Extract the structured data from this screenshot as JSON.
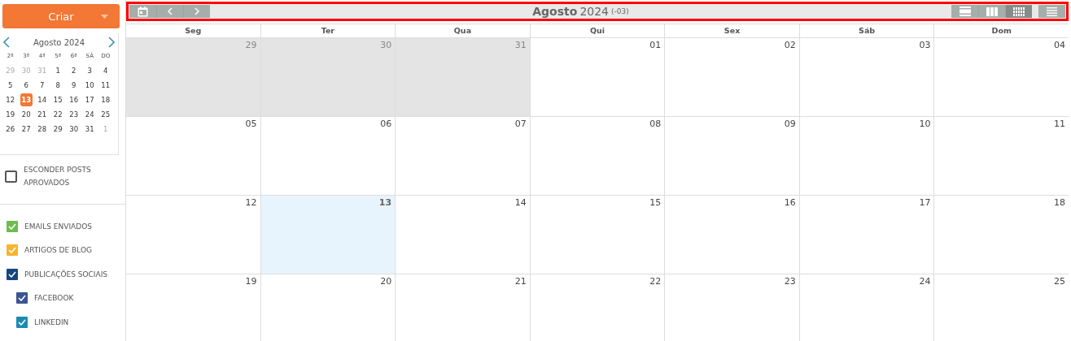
{
  "create_button": {
    "label": "Criar"
  },
  "mini_calendar": {
    "title": "Agosto 2024",
    "weekdays": [
      "2ª",
      "3ª",
      "4ª",
      "5ª",
      "6ª",
      "SÁ",
      "DO"
    ],
    "weeks": [
      [
        {
          "label": "29",
          "other_month": true,
          "selected": false
        },
        {
          "label": "30",
          "other_month": true,
          "selected": false
        },
        {
          "label": "31",
          "other_month": true,
          "selected": false
        },
        {
          "label": "1",
          "other_month": false,
          "selected": false
        },
        {
          "label": "2",
          "other_month": false,
          "selected": false
        },
        {
          "label": "3",
          "other_month": false,
          "selected": false
        },
        {
          "label": "4",
          "other_month": false,
          "selected": false
        }
      ],
      [
        {
          "label": "5",
          "other_month": false,
          "selected": false
        },
        {
          "label": "6",
          "other_month": false,
          "selected": false
        },
        {
          "label": "7",
          "other_month": false,
          "selected": false
        },
        {
          "label": "8",
          "other_month": false,
          "selected": false
        },
        {
          "label": "9",
          "other_month": false,
          "selected": false
        },
        {
          "label": "10",
          "other_month": false,
          "selected": false
        },
        {
          "label": "11",
          "other_month": false,
          "selected": false
        }
      ],
      [
        {
          "label": "12",
          "other_month": false,
          "selected": false
        },
        {
          "label": "13",
          "other_month": false,
          "selected": true
        },
        {
          "label": "14",
          "other_month": false,
          "selected": false
        },
        {
          "label": "15",
          "other_month": false,
          "selected": false
        },
        {
          "label": "16",
          "other_month": false,
          "selected": false
        },
        {
          "label": "17",
          "other_month": false,
          "selected": false
        },
        {
          "label": "18",
          "other_month": false,
          "selected": false
        }
      ],
      [
        {
          "label": "19",
          "other_month": false,
          "selected": false
        },
        {
          "label": "20",
          "other_month": false,
          "selected": false
        },
        {
          "label": "21",
          "other_month": false,
          "selected": false
        },
        {
          "label": "22",
          "other_month": false,
          "selected": false
        },
        {
          "label": "23",
          "other_month": false,
          "selected": false
        },
        {
          "label": "24",
          "other_month": false,
          "selected": false
        },
        {
          "label": "25",
          "other_month": false,
          "selected": false
        }
      ],
      [
        {
          "label": "26",
          "other_month": false,
          "selected": false
        },
        {
          "label": "27",
          "other_month": false,
          "selected": false
        },
        {
          "label": "28",
          "other_month": false,
          "selected": false
        },
        {
          "label": "29",
          "other_month": false,
          "selected": false
        },
        {
          "label": "30",
          "other_month": false,
          "selected": false
        },
        {
          "label": "31",
          "other_month": false,
          "selected": false
        },
        {
          "label": "1",
          "other_month": true,
          "selected": false
        }
      ]
    ]
  },
  "hide_approved": {
    "label": "ESCONDER POSTS APROVADOS",
    "checked": false
  },
  "filters": [
    {
      "label": "EMAILS ENVIADOS",
      "checked": true,
      "color": "#6cbd4f"
    },
    {
      "label": "ARTIGOS DE BLOG",
      "checked": true,
      "color": "#f7b52c"
    },
    {
      "label": "PUBLICAÇÕES SOCIAIS",
      "checked": true,
      "color": "#14477f",
      "children": [
        {
          "label": "FACEBOOK",
          "checked": true,
          "color": "#3b5590"
        },
        {
          "label": "LINKEDIN",
          "checked": true,
          "color": "#1a8cb0"
        }
      ]
    }
  ],
  "toolbar": {
    "title": "Agosto",
    "year": "2024",
    "timezone": "(-03)",
    "views": [
      {
        "kind": "day",
        "selected": false
      },
      {
        "kind": "week",
        "selected": false
      },
      {
        "kind": "month",
        "selected": true
      }
    ]
  },
  "calendar": {
    "weekdays": [
      "Seg",
      "Ter",
      "Qua",
      "Qui",
      "Sex",
      "Sáb",
      "Dom"
    ],
    "weeks": [
      [
        {
          "label": "29",
          "other_month": true,
          "today": false
        },
        {
          "label": "30",
          "other_month": true,
          "today": false
        },
        {
          "label": "31",
          "other_month": true,
          "today": false
        },
        {
          "label": "01",
          "other_month": false,
          "today": false
        },
        {
          "label": "02",
          "other_month": false,
          "today": false
        },
        {
          "label": "03",
          "other_month": false,
          "today": false
        },
        {
          "label": "04",
          "other_month": false,
          "today": false
        }
      ],
      [
        {
          "label": "05",
          "other_month": false,
          "today": false
        },
        {
          "label": "06",
          "other_month": false,
          "today": false
        },
        {
          "label": "07",
          "other_month": false,
          "today": false
        },
        {
          "label": "08",
          "other_month": false,
          "today": false
        },
        {
          "label": "09",
          "other_month": false,
          "today": false
        },
        {
          "label": "10",
          "other_month": false,
          "today": false
        },
        {
          "label": "11",
          "other_month": false,
          "today": false
        }
      ],
      [
        {
          "label": "12",
          "other_month": false,
          "today": false
        },
        {
          "label": "13",
          "other_month": false,
          "today": true
        },
        {
          "label": "14",
          "other_month": false,
          "today": false
        },
        {
          "label": "15",
          "other_month": false,
          "today": false
        },
        {
          "label": "16",
          "other_month": false,
          "today": false
        },
        {
          "label": "17",
          "other_month": false,
          "today": false
        },
        {
          "label": "18",
          "other_month": false,
          "today": false
        }
      ],
      [
        {
          "label": "19",
          "other_month": false,
          "today": false
        },
        {
          "label": "20",
          "other_month": false,
          "today": false
        },
        {
          "label": "21",
          "other_month": false,
          "today": false
        },
        {
          "label": "22",
          "other_month": false,
          "today": false
        },
        {
          "label": "23",
          "other_month": false,
          "today": false
        },
        {
          "label": "24",
          "other_month": false,
          "today": false
        },
        {
          "label": "25",
          "other_month": false,
          "today": false
        }
      ]
    ]
  }
}
